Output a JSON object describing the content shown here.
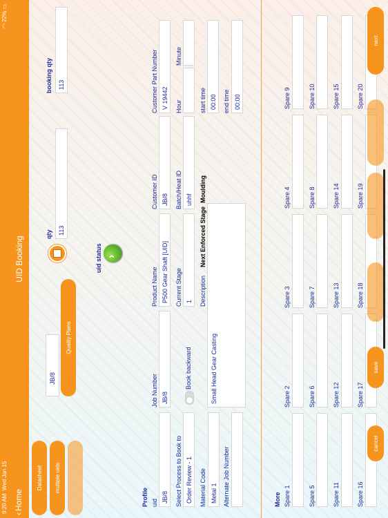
{
  "status_bar": {
    "time": "9:20 AM",
    "date": "Wed Jan 15",
    "battery": "22%"
  },
  "nav": {
    "back_label": "Home",
    "title": "UID Booking"
  },
  "side_buttons": [
    "Datasheet",
    "multiple uids",
    "",
    ""
  ],
  "uid": {
    "label": "uid",
    "value": "JB/8",
    "status_label": "uid status"
  },
  "qty": {
    "label": "qty",
    "value": "113"
  },
  "booking_qty": {
    "label": "booking qty",
    "value": "113"
  },
  "quality_plans_label": "Quality Plans",
  "profile": {
    "heading": "Profile",
    "uid_label": "uid",
    "uid_value": "JB/8",
    "job_number_label": "Job Number",
    "job_number_value": "JB/8",
    "product_name_label": "Product Name",
    "product_name_value": "P500 Gear Shaft [UID]",
    "customer_id_label": "Customer ID",
    "customer_id_value": "JB/8",
    "customer_part_label": "Customer Part Number",
    "customer_part_value": "V 19442",
    "select_process_label": "Select Process to Book to",
    "select_process_value": "Order Review - 1",
    "book_backward_label": "Book backward",
    "current_stage_label": "Current Stage",
    "current_stage_value": "1",
    "batch_heat_label": "Batch/Heat ID",
    "batch_heat_value": "uhhf",
    "hour_label": "Hour",
    "minute_label": "Minute",
    "material_code_label": "Material Code",
    "material_code_value": "Metal 1",
    "description_label": "Description",
    "description_value": "Small Head Gear Casting",
    "next_stage_label": "Next Enforced Stage",
    "next_stage_value": "Moulding",
    "start_time_label": "start time",
    "start_time_value": "00:00",
    "end_time_label": "end time",
    "end_time_value": "00:00",
    "alternate_job_label": "Alternate Job Number"
  },
  "more": {
    "heading": "More",
    "spares": [
      "Spare 1",
      "Spare 2",
      "Spare 3",
      "Spare 4",
      "Spare 5",
      "Spare 6",
      "Spare 7",
      "Spare 8",
      "Spare 9",
      "Spare 10",
      "Spare 11",
      "Spare 12",
      "Spare 13",
      "Spare 14",
      "Spare 15",
      "Spare 16",
      "Spare 17",
      "Spare 18",
      "Spare 19",
      "Spare 20"
    ]
  },
  "bottom_buttons": {
    "cancel": "cancel",
    "save": "save",
    "next": "next"
  },
  "colors": {
    "accent": "#f7941d",
    "label_blue": "#1b2a9c",
    "status_green": "#3aa31a"
  }
}
